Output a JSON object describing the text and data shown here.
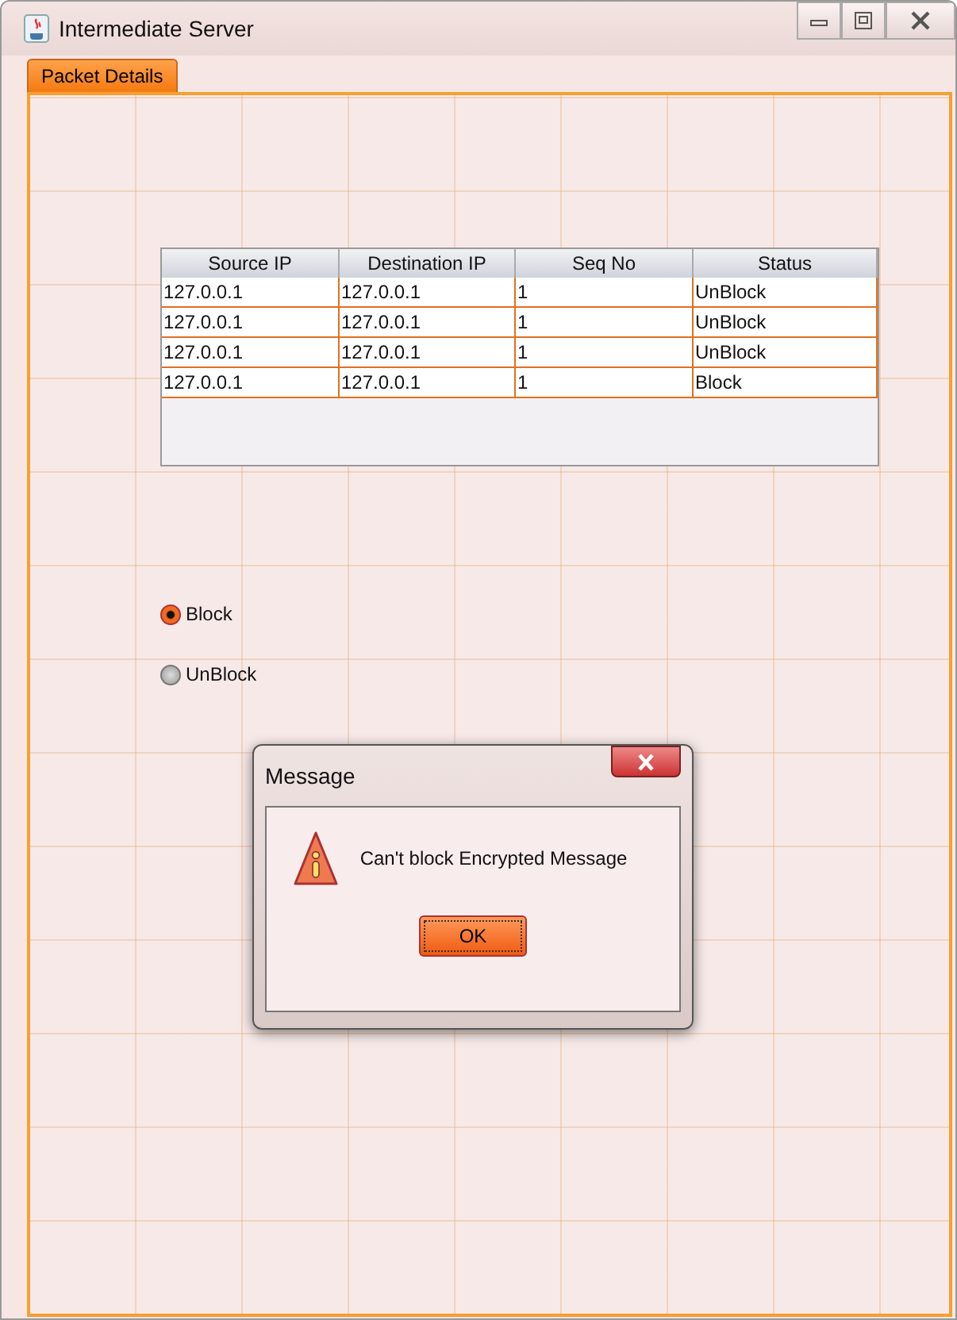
{
  "window": {
    "title": "Intermediate Server"
  },
  "tabs": [
    {
      "label": "Packet Details",
      "selected": true
    }
  ],
  "table": {
    "columns": [
      "Source IP",
      "Destination IP",
      "Seq No",
      "Status"
    ],
    "rows": [
      [
        "127.0.0.1",
        "127.0.0.1",
        "1",
        "UnBlock"
      ],
      [
        "127.0.0.1",
        "127.0.0.1",
        "1",
        "UnBlock"
      ],
      [
        "127.0.0.1",
        "127.0.0.1",
        "1",
        "UnBlock"
      ],
      [
        "127.0.0.1",
        "127.0.0.1",
        "1",
        "Block"
      ]
    ]
  },
  "radios": [
    {
      "label": "Block",
      "selected": true
    },
    {
      "label": "UnBlock",
      "selected": false
    }
  ],
  "dialog": {
    "title": "Message",
    "message": "Can't block Encrypted Message",
    "button": "OK"
  }
}
